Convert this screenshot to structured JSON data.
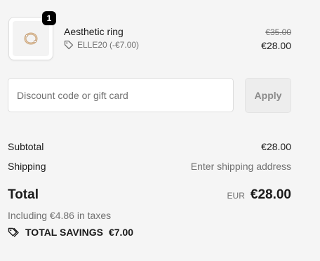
{
  "line_item": {
    "quantity": "1",
    "name": "Aesthetic ring",
    "discount_code": "ELLE20 (-€7.00)",
    "original_price": "€35.00",
    "price": "€28.00",
    "image_icon": "ring-image"
  },
  "discount": {
    "placeholder": "Discount code or gift card",
    "value": "",
    "apply_label": "Apply",
    "tag_icon": "tag-icon"
  },
  "summary": {
    "subtotal_label": "Subtotal",
    "subtotal_value": "€28.00",
    "shipping_label": "Shipping",
    "shipping_value": "Enter shipping address",
    "total_label": "Total",
    "total_currency": "EUR",
    "total_value": "€28.00",
    "taxes_note": "Including €4.86 in taxes",
    "savings_label": "TOTAL SAVINGS",
    "savings_value": "€7.00",
    "savings_icon": "tags-icon"
  },
  "colors": {
    "background": "#f5f5f5",
    "text": "#1a1a1a",
    "muted_text": "#707070",
    "badge": "#000000",
    "button_bg": "#ededed",
    "button_text": "#8a8a8a"
  }
}
